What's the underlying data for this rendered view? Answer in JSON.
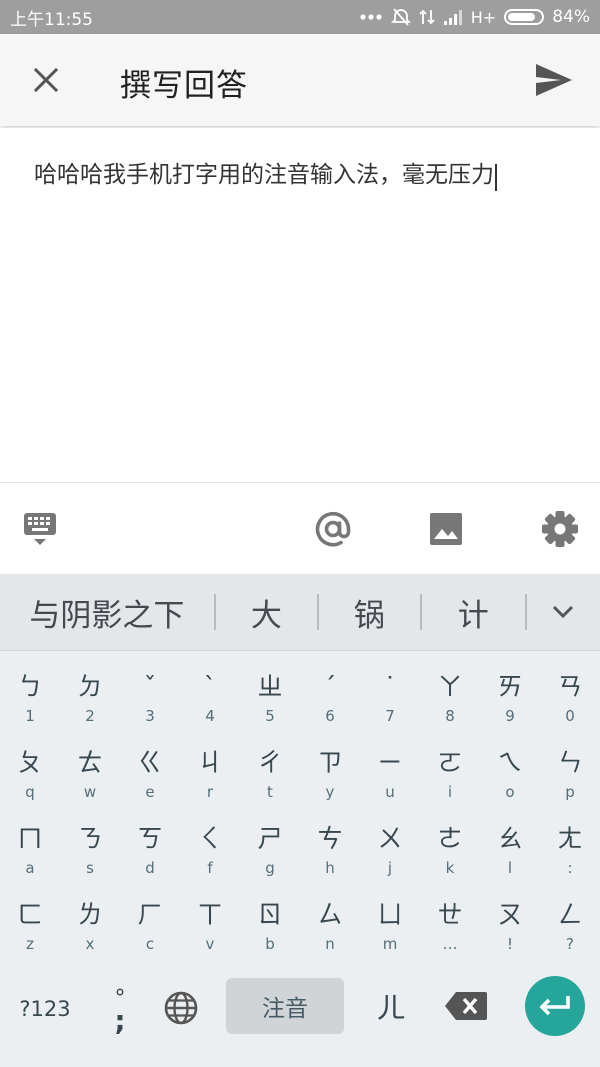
{
  "status_bar": {
    "time": "上午11:55",
    "network": "H+",
    "battery": "84%",
    "battery_level": 0.84
  },
  "app_bar": {
    "title": "撰写回答",
    "close_icon": "close-icon",
    "send_icon": "send-icon"
  },
  "editor": {
    "text": "哈哈哈我手机打字用的注音输入法，毫无压力"
  },
  "toolbar": {
    "icons": [
      "keyboard-hide-icon",
      "at-icon",
      "image-icon",
      "settings-icon"
    ]
  },
  "candidates": {
    "items": [
      "与阴影之下",
      "大",
      "锅",
      "计"
    ],
    "expand_icon": "chevron-down-icon"
  },
  "keyboard": {
    "rows": [
      [
        {
          "zhuyin": "ㄅ",
          "latin": "1"
        },
        {
          "zhuyin": "ㄉ",
          "latin": "2"
        },
        {
          "zhuyin": "ˇ",
          "latin": "3"
        },
        {
          "zhuyin": "ˋ",
          "latin": "4"
        },
        {
          "zhuyin": "ㄓ",
          "latin": "5"
        },
        {
          "zhuyin": "ˊ",
          "latin": "6"
        },
        {
          "zhuyin": "˙",
          "latin": "7"
        },
        {
          "zhuyin": "ㄚ",
          "latin": "8"
        },
        {
          "zhuyin": "ㄞ",
          "latin": "9"
        },
        {
          "zhuyin": "ㄢ",
          "latin": "0"
        }
      ],
      [
        {
          "zhuyin": "ㄆ",
          "latin": "q"
        },
        {
          "zhuyin": "ㄊ",
          "latin": "w"
        },
        {
          "zhuyin": "ㄍ",
          "latin": "e"
        },
        {
          "zhuyin": "ㄐ",
          "latin": "r"
        },
        {
          "zhuyin": "ㄔ",
          "latin": "t"
        },
        {
          "zhuyin": "ㄗ",
          "latin": "y"
        },
        {
          "zhuyin": "ㄧ",
          "latin": "u"
        },
        {
          "zhuyin": "ㄛ",
          "latin": "i"
        },
        {
          "zhuyin": "ㄟ",
          "latin": "o"
        },
        {
          "zhuyin": "ㄣ",
          "latin": "p"
        }
      ],
      [
        {
          "zhuyin": "ㄇ",
          "latin": "a"
        },
        {
          "zhuyin": "ㄋ",
          "latin": "s"
        },
        {
          "zhuyin": "ㄎ",
          "latin": "d"
        },
        {
          "zhuyin": "ㄑ",
          "latin": "f"
        },
        {
          "zhuyin": "ㄕ",
          "latin": "g"
        },
        {
          "zhuyin": "ㄘ",
          "latin": "h"
        },
        {
          "zhuyin": "ㄨ",
          "latin": "j"
        },
        {
          "zhuyin": "ㄜ",
          "latin": "k"
        },
        {
          "zhuyin": "ㄠ",
          "latin": "l"
        },
        {
          "zhuyin": "ㄤ",
          "latin": ":"
        }
      ],
      [
        {
          "zhuyin": "ㄈ",
          "latin": "z"
        },
        {
          "zhuyin": "ㄌ",
          "latin": "x"
        },
        {
          "zhuyin": "ㄏ",
          "latin": "c"
        },
        {
          "zhuyin": "ㄒ",
          "latin": "v"
        },
        {
          "zhuyin": "ㄖ",
          "latin": "b"
        },
        {
          "zhuyin": "ㄙ",
          "latin": "n"
        },
        {
          "zhuyin": "ㄩ",
          "latin": "m"
        },
        {
          "zhuyin": "ㄝ",
          "latin": "…"
        },
        {
          "zhuyin": "ㄡ",
          "latin": "!"
        },
        {
          "zhuyin": "ㄥ",
          "latin": "?"
        }
      ]
    ],
    "symbols_key": "?123",
    "punct_top": "°",
    "punct_bottom": ";",
    "space_label": "注音",
    "er_key": "ㄦ",
    "enter_color": "#26a69a"
  }
}
